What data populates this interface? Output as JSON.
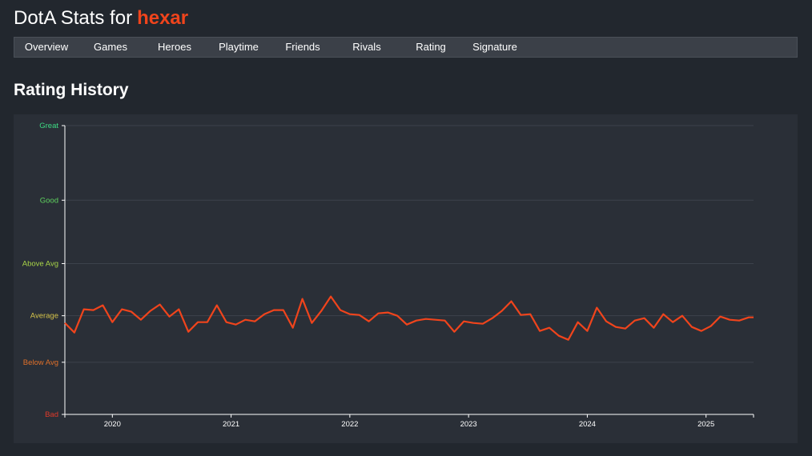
{
  "header": {
    "prefix": "DotA Stats for",
    "username": "hexar"
  },
  "nav": {
    "items": [
      {
        "label": "Overview"
      },
      {
        "label": "Games"
      },
      {
        "label": "Heroes"
      },
      {
        "label": "Playtime"
      },
      {
        "label": "Friends"
      },
      {
        "label": "Rivals"
      },
      {
        "label": "Rating"
      },
      {
        "label": "Signature"
      }
    ]
  },
  "section": {
    "title": "Rating History"
  },
  "colors": {
    "line": "#f0441c",
    "great": "#3ddc84",
    "good": "#5fd35f",
    "above_avg": "#a8d448",
    "average": "#d4c24a",
    "below_avg": "#e0702a",
    "bad": "#e03a2a"
  },
  "chart_data": {
    "type": "line",
    "title": "",
    "xlabel": "",
    "ylabel": "",
    "x_ticks": [
      "2020",
      "2021",
      "2022",
      "2023",
      "2024",
      "2025"
    ],
    "xlim": [
      2019.6,
      2025.4
    ],
    "ylim": [
      0,
      360
    ],
    "grid": true,
    "y_levels": [
      {
        "label": "Great",
        "value": 360,
        "color_key": "great"
      },
      {
        "label": "Good",
        "value": 267,
        "color_key": "good"
      },
      {
        "label": "Above Avg",
        "value": 188,
        "color_key": "above_avg"
      },
      {
        "label": "Average",
        "value": 123,
        "color_key": "average"
      },
      {
        "label": "Below Avg",
        "value": 65,
        "color_key": "below_avg"
      },
      {
        "label": "Bad",
        "value": 0,
        "color_key": "bad"
      }
    ],
    "series": [
      {
        "x": [
          2019.6,
          2019.68,
          2019.76,
          2019.84,
          2019.92,
          2020.0,
          2020.08,
          2020.16,
          2020.24,
          2020.32,
          2020.4,
          2020.48,
          2020.56,
          2020.64,
          2020.72,
          2020.8,
          2020.88,
          2020.96,
          2021.04,
          2021.12,
          2021.2,
          2021.28,
          2021.36,
          2021.44,
          2021.52,
          2021.6,
          2021.68,
          2021.76,
          2021.84,
          2021.92,
          2022.0,
          2022.08,
          2022.16,
          2022.24,
          2022.32,
          2022.4,
          2022.48,
          2022.56,
          2022.64,
          2022.72,
          2022.8,
          2022.88,
          2022.96,
          2023.04,
          2023.12,
          2023.2,
          2023.28,
          2023.36,
          2023.44,
          2023.52,
          2023.6,
          2023.68,
          2023.76,
          2023.84,
          2023.92,
          2024.0,
          2024.08,
          2024.16,
          2024.24,
          2024.32,
          2024.4,
          2024.48,
          2024.56,
          2024.64,
          2024.72,
          2024.8,
          2024.88,
          2024.96,
          2025.04,
          2025.12,
          2025.2,
          2025.28,
          2025.36,
          2025.4
        ],
        "y": [
          114,
          102,
          131,
          130,
          136,
          115,
          131,
          128,
          118,
          129,
          137,
          122,
          131,
          103,
          115,
          115,
          136,
          115,
          112,
          118,
          116,
          125,
          130,
          130,
          108,
          144,
          114,
          129,
          147,
          130,
          125,
          124,
          116,
          126,
          127,
          123,
          112,
          117,
          119,
          118,
          117,
          103,
          116,
          114,
          113,
          120,
          129,
          141,
          124,
          125,
          104,
          108,
          98,
          93,
          115,
          104,
          133,
          116,
          109,
          107,
          117,
          120,
          108,
          125,
          115,
          123,
          109,
          104,
          110,
          122,
          118,
          117,
          121,
          121
        ]
      }
    ]
  }
}
